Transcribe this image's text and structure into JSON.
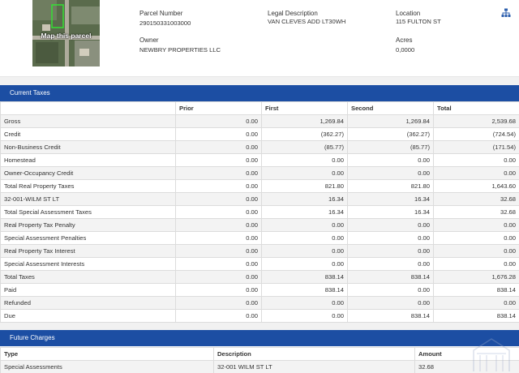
{
  "map": {
    "label": "Map this parcel",
    "icon": "parcel-map-thumbnail"
  },
  "parcel": {
    "number_label": "Parcel Number",
    "number": "290150331003000",
    "owner_label": "Owner",
    "owner": "NEWBRY PROPERTIES LLC",
    "legal_label": "Legal Description",
    "legal": "VAN CLEVES ADD LT30WH",
    "location_label": "Location",
    "location": "115 FULTON ST",
    "acres_label": "Acres",
    "acres": "0,0000"
  },
  "share_icon": "sitemap-icon",
  "current_taxes": {
    "title": "Current Taxes",
    "columns": [
      "",
      "Prior",
      "First",
      "Second",
      "Total"
    ],
    "rows": [
      [
        "Gross",
        "0.00",
        "1,269.84",
        "1,269.84",
        "2,539.68"
      ],
      [
        "Credit",
        "0.00",
        "(362.27)",
        "(362.27)",
        "(724.54)"
      ],
      [
        "Non-Business Credit",
        "0.00",
        "(85.77)",
        "(85.77)",
        "(171.54)"
      ],
      [
        "Homestead",
        "0.00",
        "0.00",
        "0.00",
        "0.00"
      ],
      [
        "Owner-Occupancy Credit",
        "0.00",
        "0.00",
        "0.00",
        "0.00"
      ],
      [
        "Total Real Property Taxes",
        "0.00",
        "821.80",
        "821.80",
        "1,643.60"
      ],
      [
        "32-001-WILM ST LT",
        "0.00",
        "16.34",
        "16.34",
        "32.68"
      ],
      [
        "Total Special Assessment Taxes",
        "0.00",
        "16.34",
        "16.34",
        "32.68"
      ],
      [
        "Real Property Tax Penalty",
        "0.00",
        "0.00",
        "0.00",
        "0.00"
      ],
      [
        "Special Assessment Penalties",
        "0.00",
        "0.00",
        "0.00",
        "0.00"
      ],
      [
        "Real Property Tax Interest",
        "0.00",
        "0.00",
        "0.00",
        "0.00"
      ],
      [
        "Special Assessment Interests",
        "0.00",
        "0.00",
        "0.00",
        "0.00"
      ],
      [
        "Total Taxes",
        "0.00",
        "838.14",
        "838.14",
        "1,676.28"
      ],
      [
        "Paid",
        "0.00",
        "838.14",
        "0.00",
        "838.14"
      ],
      [
        "Refunded",
        "0.00",
        "0.00",
        "0.00",
        "0.00"
      ],
      [
        "Due",
        "0.00",
        "0.00",
        "838.14",
        "838.14"
      ]
    ]
  },
  "future_charges": {
    "title": "Future Charges",
    "columns": [
      "Type",
      "Description",
      "Amount"
    ],
    "rows": [
      [
        "Special Assessments",
        "32-001 WILM ST LT",
        "32.68"
      ]
    ]
  },
  "colors": {
    "band": "#1c4ea3",
    "alt_row": "#f3f3f3",
    "border": "#dcdcdc"
  }
}
